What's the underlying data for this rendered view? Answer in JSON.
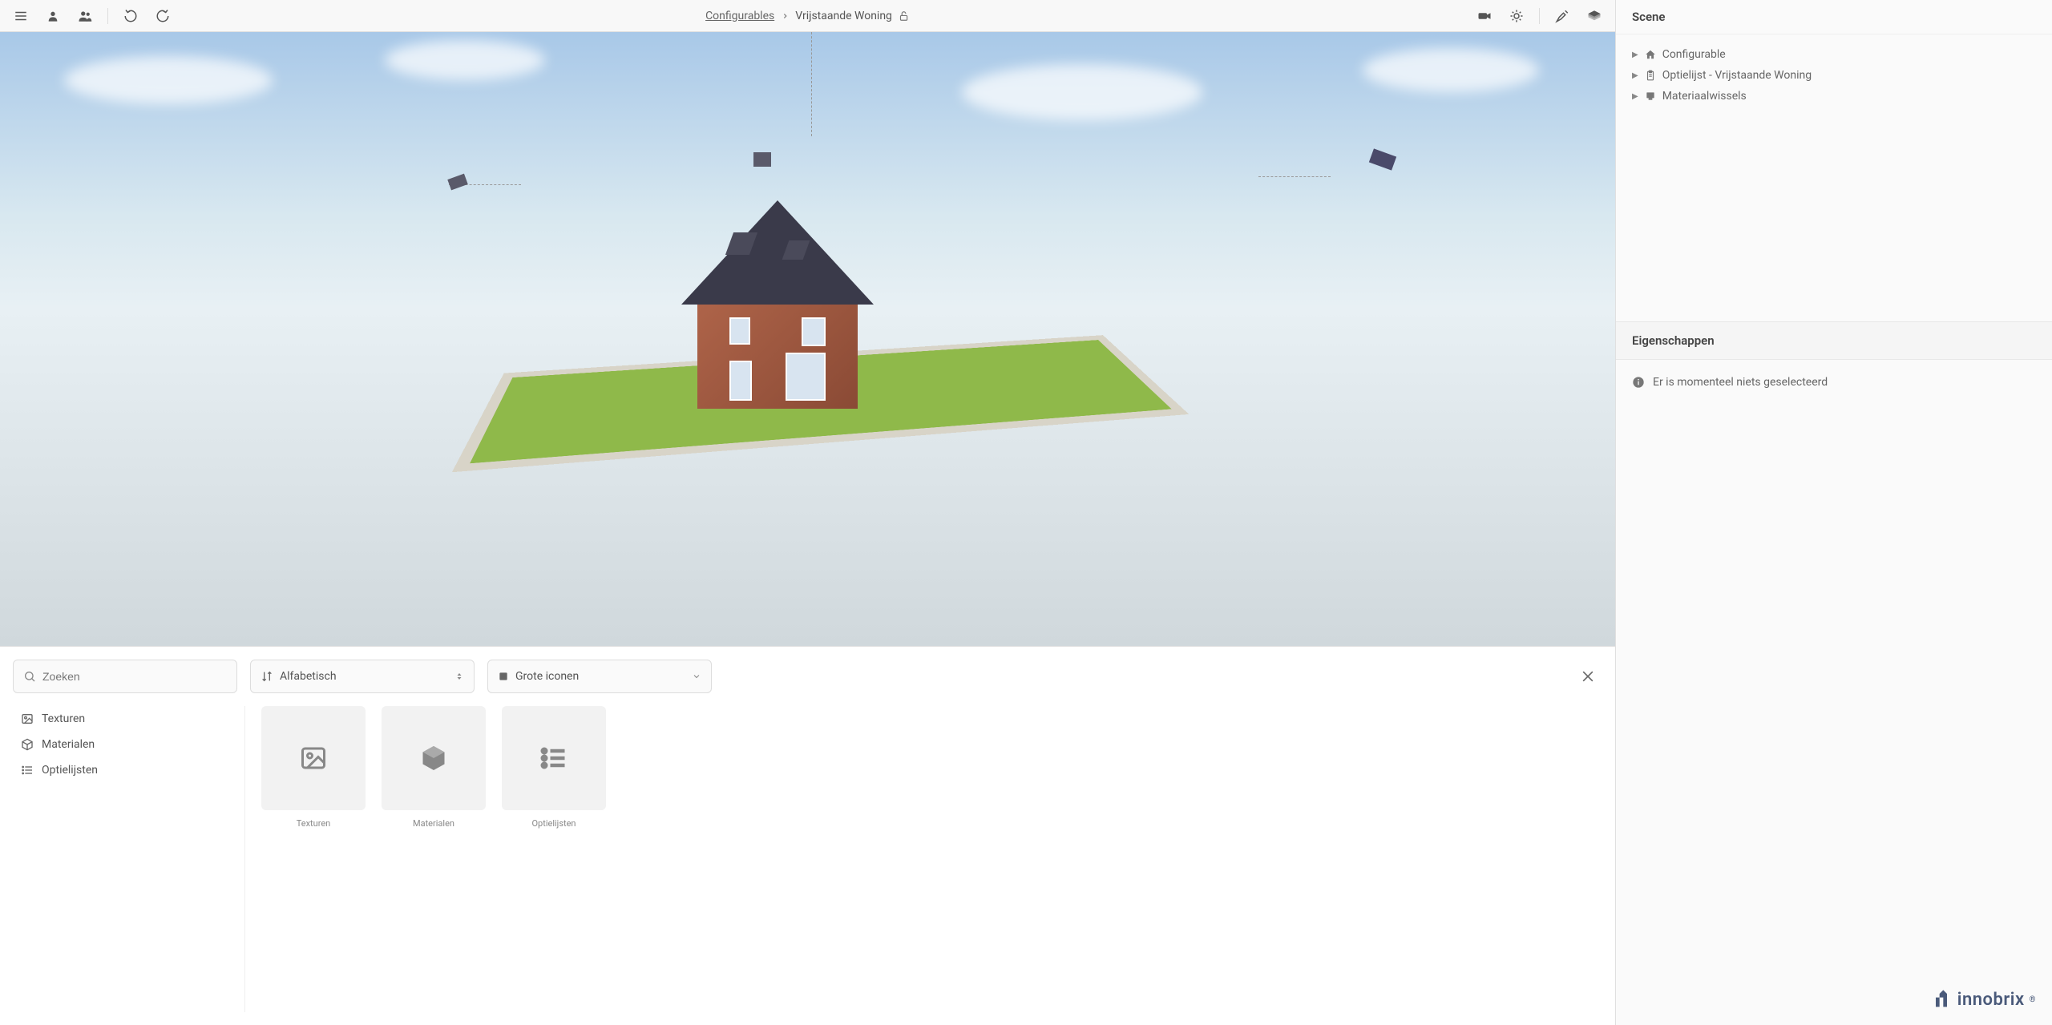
{
  "toolbar": {
    "breadcrumb_root": "Configurables",
    "breadcrumb_current": "Vrijstaande Woning"
  },
  "scene": {
    "header": "Scene",
    "tree": [
      {
        "icon": "home",
        "label": "Configurable"
      },
      {
        "icon": "clipboard",
        "label": "Optielijst - Vrijstaande Woning"
      },
      {
        "icon": "layers",
        "label": "Materiaalwissels"
      }
    ]
  },
  "properties": {
    "header": "Eigenschappen",
    "empty_message": "Er is momenteel niets geselecteerd"
  },
  "asset_panel": {
    "search_placeholder": "Zoeken",
    "sort_label": "Alfabetisch",
    "view_label": "Grote iconen",
    "categories": [
      {
        "icon": "image",
        "label": "Texturen"
      },
      {
        "icon": "cube",
        "label": "Materialen"
      },
      {
        "icon": "list",
        "label": "Optielijsten"
      }
    ],
    "items": [
      {
        "icon": "image",
        "label": "Texturen"
      },
      {
        "icon": "cube",
        "label": "Materialen"
      },
      {
        "icon": "list",
        "label": "Optielijsten"
      }
    ]
  },
  "brand": "innobrix",
  "colors": {
    "grass": "#8fb94a",
    "brick": "#9a5238",
    "roof": "#3a3a4a",
    "sky_top": "#a8c8e8",
    "ground": "#d0d8dc"
  }
}
